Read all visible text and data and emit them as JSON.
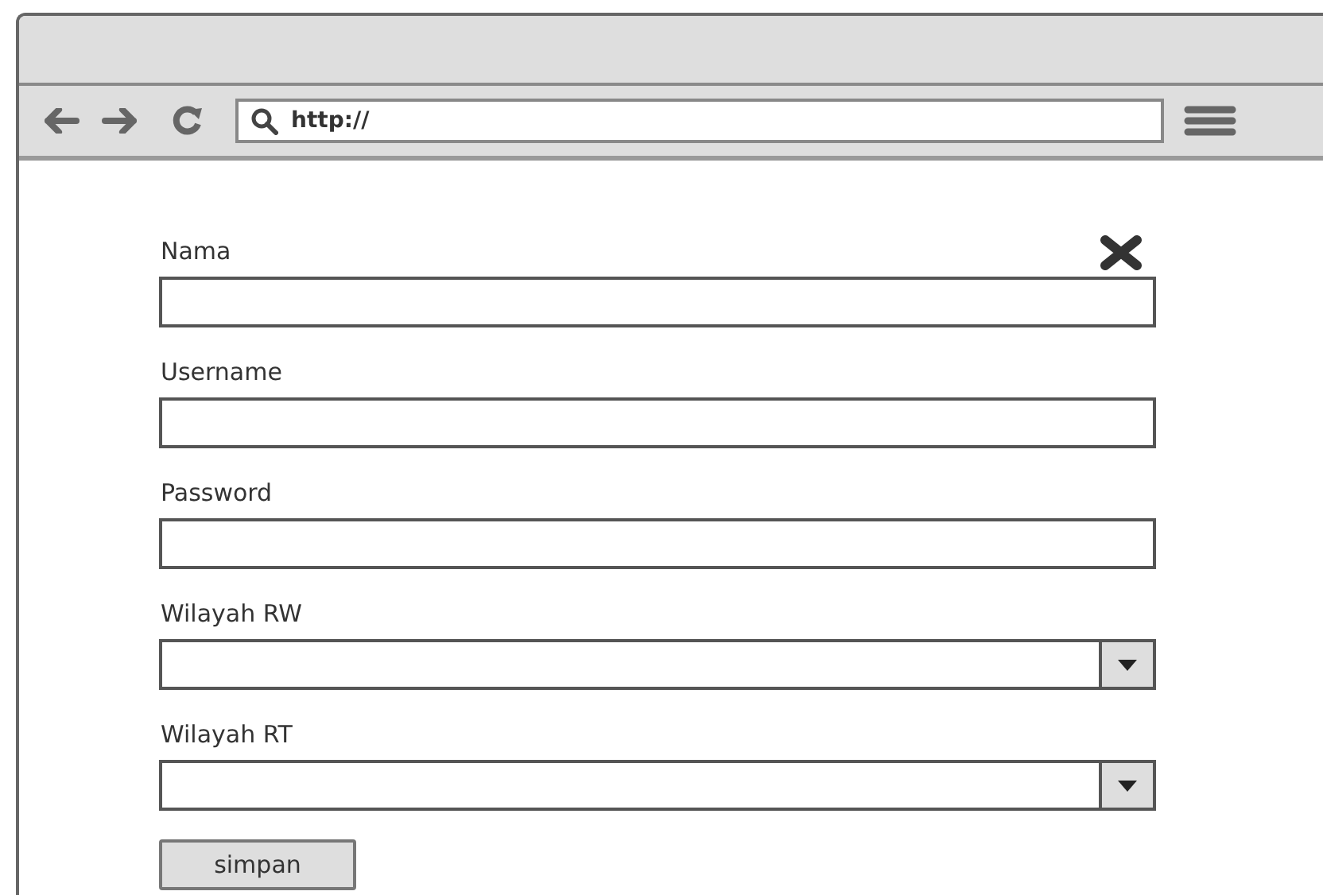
{
  "browser": {
    "address": "http://"
  },
  "fields": [
    {
      "label": "Nama",
      "kind": "text"
    },
    {
      "label": "Username",
      "kind": "text"
    },
    {
      "label": "Password",
      "kind": "text"
    },
    {
      "label": "Wilayah RW",
      "kind": "select"
    },
    {
      "label": "Wilayah RT",
      "kind": "select"
    }
  ],
  "buttons": [
    {
      "label": "simpan"
    }
  ]
}
